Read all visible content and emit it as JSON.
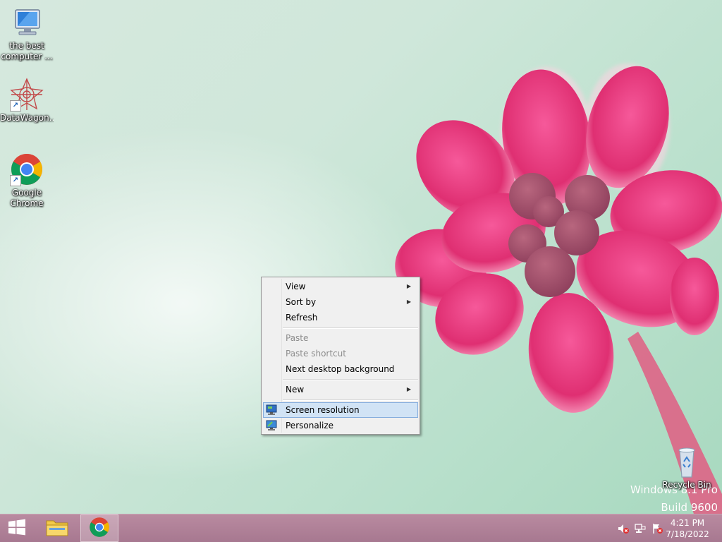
{
  "desktop": {
    "icons": [
      {
        "label_line1": "the best",
        "label_line2": "computer ..."
      },
      {
        "label_line1": "DataWagon..."
      },
      {
        "label_line1": "Google",
        "label_line2": "Chrome"
      }
    ],
    "recycle_bin": {
      "label": "Recycle Bin"
    },
    "watermark": {
      "line1": "Windows 8.1 Pro",
      "line2": "Build 9600"
    }
  },
  "context_menu": {
    "items": [
      {
        "label": "View",
        "submenu": true,
        "enabled": true
      },
      {
        "label": "Sort by",
        "submenu": true,
        "enabled": true
      },
      {
        "label": "Refresh",
        "enabled": true
      },
      {
        "label": "Paste",
        "enabled": false
      },
      {
        "label": "Paste shortcut",
        "enabled": false
      },
      {
        "label": "Next desktop background",
        "enabled": true
      },
      {
        "label": "New",
        "submenu": true,
        "enabled": true
      },
      {
        "label": "Screen resolution",
        "enabled": true,
        "highlighted": true,
        "icon": "monitor-resolution-icon"
      },
      {
        "label": "Personalize",
        "enabled": true,
        "icon": "personalize-icon"
      }
    ],
    "submenu_arrow": "▶"
  },
  "taskbar": {
    "start_icon": "windows-logo-icon",
    "pinned": [
      "file-explorer-icon",
      "chrome-icon"
    ],
    "active": "chrome-icon",
    "tray_icons": [
      "volume-muted-icon",
      "network-icon",
      "action-center-flag-icon"
    ],
    "clock": {
      "time": "4:21 PM",
      "date": "7/18/2022"
    }
  },
  "colors": {
    "taskbar": "#b07f97",
    "menu_highlight": "#d1e3f5",
    "flower": "#d9326e"
  }
}
